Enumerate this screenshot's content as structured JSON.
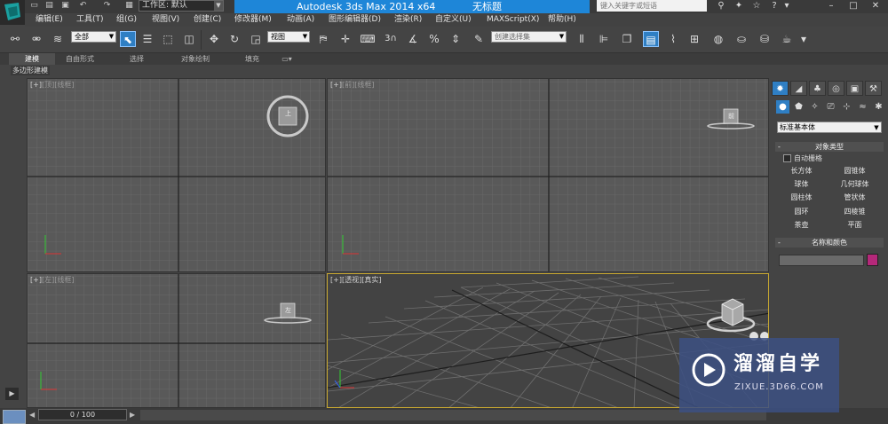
{
  "titlebar": {
    "workspace_label": "工作区: 默认",
    "app_title": "Autodesk 3ds Max  2014 x64",
    "doc_title": "无标题",
    "search_placeholder": "键入关键字或短语"
  },
  "menu": [
    {
      "label": "编辑(E)"
    },
    {
      "label": "工具(T)"
    },
    {
      "label": "组(G)"
    },
    {
      "label": "视图(V)"
    },
    {
      "label": "创建(C)"
    },
    {
      "label": "修改器(M)"
    },
    {
      "label": "动画(A)"
    },
    {
      "label": "图形编辑器(D)"
    },
    {
      "label": "渲染(R)"
    },
    {
      "label": "自定义(U)"
    },
    {
      "label": "MAXScript(X)"
    },
    {
      "label": "帮助(H)"
    }
  ],
  "toolbar": {
    "filter_value": "全部",
    "coord_value": "视图",
    "selection_set_placeholder": "创建选择集",
    "snap_label": "3"
  },
  "ribbon": {
    "tabs": [
      {
        "label": "建模",
        "active": true
      },
      {
        "label": "自由形式"
      },
      {
        "label": "选择"
      },
      {
        "label": "对象绘制"
      },
      {
        "label": "填充"
      }
    ],
    "sub_label": "多边形建模"
  },
  "viewports": {
    "top": {
      "plus": "[+]",
      "name": "[顶]",
      "shade": "[线框]",
      "cube": "上"
    },
    "front": {
      "plus": "[+]",
      "name": "[前]",
      "shade": "[线框]",
      "cube": "前"
    },
    "left": {
      "plus": "[+]",
      "name": "[左]",
      "shade": "[线框]",
      "cube": "左"
    },
    "persp": {
      "plus": "[+]",
      "name": "[透视]",
      "shade": "[真实]"
    }
  },
  "command_panel": {
    "primitive_type": "标准基本体",
    "object_type_title": "对象类型",
    "auto_grid": "自动栅格",
    "objects": [
      "长方体",
      "圆锥体",
      "球体",
      "几何球体",
      "圆柱体",
      "管状体",
      "圆环",
      "四棱锥",
      "茶壶",
      "平面"
    ],
    "name_color_title": "名称和颜色",
    "object_color": "#b5287a"
  },
  "timeline": {
    "frame_label": "0 / 100"
  },
  "watermark": {
    "title": "溜溜自学",
    "url": "ZIXUE.3D66.COM"
  },
  "colors": {
    "title_blue": "#1e86d8",
    "active_blue": "#2f7fc4",
    "persp_border": "#c8a830"
  }
}
